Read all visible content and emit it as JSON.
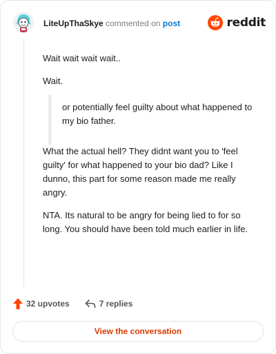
{
  "header": {
    "author": "LiteUpThaSkye",
    "commented_text": "commented on",
    "post_link": "post",
    "brand": "reddit"
  },
  "comment": {
    "paragraphs_before_quote": [
      "Wait wait wait wait..",
      "Wait."
    ],
    "quote": "or potentially feel guilty about what happened to my bio father.",
    "paragraphs_after_quote": [
      "What the actual hell? They didnt want you to 'feel guilty' for what happened to your bio dad? Like I dunno, this part for some reason made me really angry.",
      "NTA. Its natural to be angry for being lied to for so long. You should have been told much earlier in life."
    ]
  },
  "actions": {
    "upvotes": "32 upvotes",
    "replies": "7 replies"
  },
  "view_button": "View the conversation",
  "colors": {
    "accent": "#ff4500",
    "link": "#0079d3",
    "button_text": "#d93a00"
  }
}
